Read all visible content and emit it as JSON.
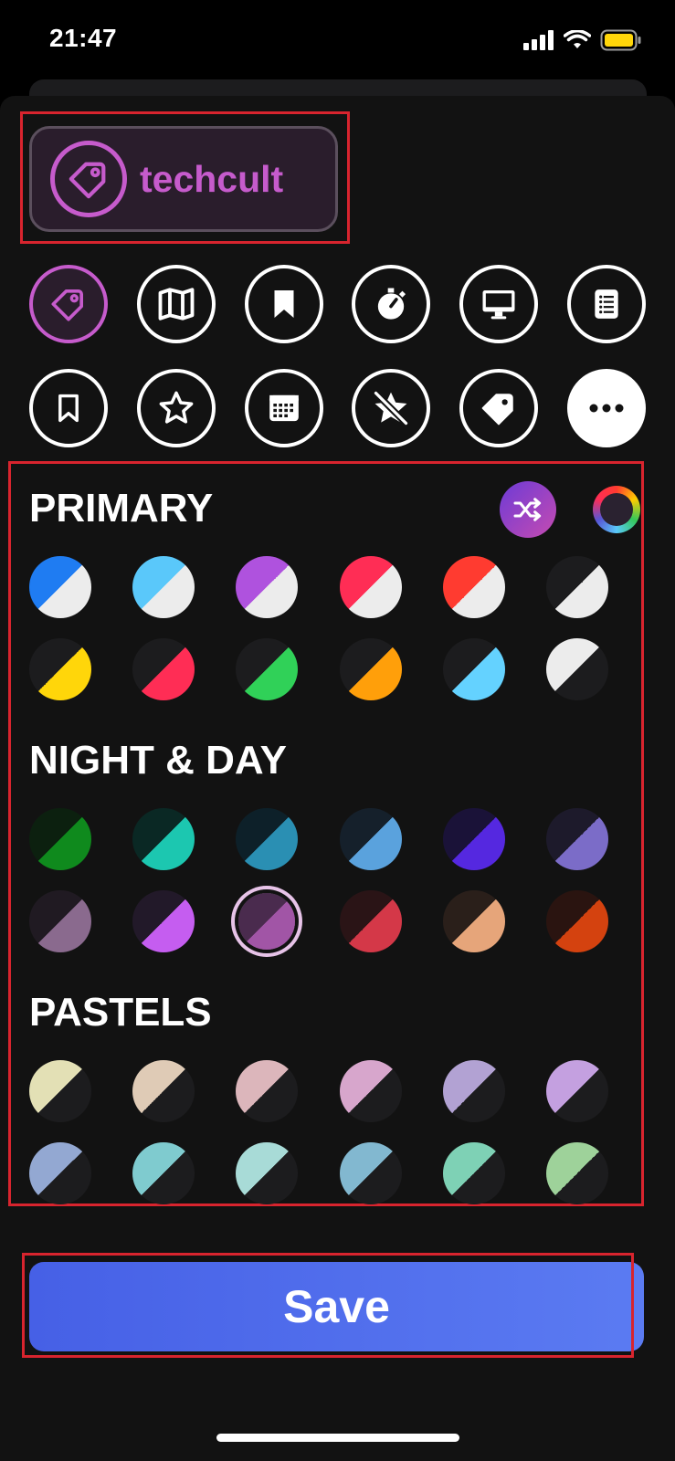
{
  "status_bar": {
    "time": "21:47",
    "battery_color": "#ffd60a"
  },
  "tag_preview": {
    "icon": "tag-icon",
    "name": "techcult",
    "accent": "#c65bcc"
  },
  "icon_rows": [
    [
      "tag-icon",
      "map-icon",
      "bookmark-filled-icon",
      "stopwatch-icon",
      "desktop-icon",
      "list-document-icon"
    ],
    [
      "bookmark-outline-icon",
      "star-icon",
      "calendar-icon",
      "star-slash-icon",
      "tag-filled-icon",
      "more-icon"
    ]
  ],
  "sections": [
    {
      "title": "PRIMARY",
      "rows": [
        [
          [
            "#1f7cf2",
            "#ececec"
          ],
          [
            "#5ac8fa",
            "#ececec"
          ],
          [
            "#af52de",
            "#ececec"
          ],
          [
            "#ff2d55",
            "#ececec"
          ],
          [
            "#ff3b30",
            "#ececec"
          ],
          [
            "#1c1c1e",
            "#ececec"
          ]
        ],
        [
          [
            "#1c1c1e",
            "#ffd60a"
          ],
          [
            "#1c1c1e",
            "#ff2d55"
          ],
          [
            "#1c1c1e",
            "#30d158"
          ],
          [
            "#1c1c1e",
            "#ff9f0a"
          ],
          [
            "#1c1c1e",
            "#64d2ff"
          ],
          [
            "#ececec",
            "#1c1c1e"
          ]
        ]
      ]
    },
    {
      "title": "NIGHT & DAY",
      "rows": [
        [
          [
            "#0c200f",
            "#0f8a1d"
          ],
          [
            "#0a2824",
            "#1cc7b0"
          ],
          [
            "#0d2029",
            "#2a8fb3"
          ],
          [
            "#15202b",
            "#5aa2dd"
          ],
          [
            "#1a1238",
            "#5528e0"
          ],
          [
            "#1d1a2b",
            "#7b6cc8"
          ]
        ],
        [
          [
            "#201a22",
            "#8a6a8e"
          ],
          [
            "#221929",
            "#c55df0"
          ],
          [
            "#4a2b4e",
            "#a155a6"
          ],
          [
            "#2a1416",
            "#d43848"
          ],
          [
            "#2a1f1a",
            "#e6a57a"
          ],
          [
            "#2a1410",
            "#d4420f"
          ]
        ]
      ]
    },
    {
      "title": "PASTELS",
      "rows": [
        [
          [
            "#e3e0b5",
            "#1c1c1e"
          ],
          [
            "#dfcbb6",
            "#1c1c1e"
          ],
          [
            "#dcb6bb",
            "#1c1c1e"
          ],
          [
            "#d7a6cc",
            "#1c1c1e"
          ],
          [
            "#b2a2d3",
            "#1c1c1e"
          ],
          [
            "#c4a0e0",
            "#1c1c1e"
          ]
        ],
        [
          [
            "#93a8d2",
            "#1c1c1e"
          ],
          [
            "#7fcbcf",
            "#1c1c1e"
          ],
          [
            "#a8dbd7",
            "#1c1c1e"
          ],
          [
            "#82b8d0",
            "#1c1c1e"
          ],
          [
            "#7ed1b5",
            "#1c1c1e"
          ],
          [
            "#9ed29a",
            "#1c1c1e"
          ]
        ]
      ]
    }
  ],
  "selected_swatch": {
    "section": 1,
    "row": 1,
    "col": 2
  },
  "save_label": "Save"
}
